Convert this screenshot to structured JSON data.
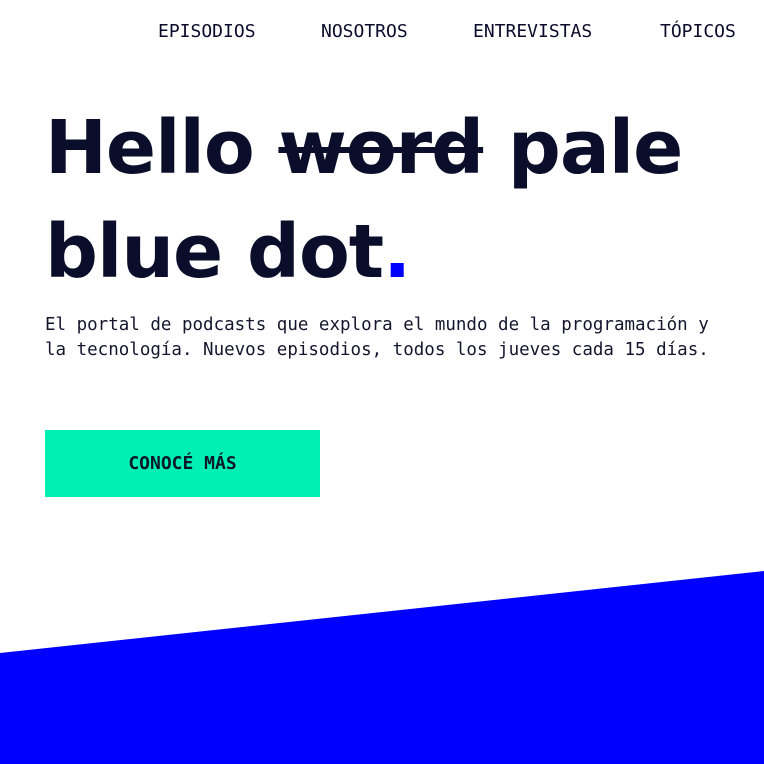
{
  "nav": {
    "items": [
      {
        "label": "EPISODIOS"
      },
      {
        "label": "NOSOTROS"
      },
      {
        "label": "ENTREVISTAS"
      },
      {
        "label": "TÓPICOS"
      }
    ]
  },
  "hero": {
    "headline_part1": "Hello ",
    "headline_struck": "word",
    "headline_part2": " pale blue dot",
    "headline_accent": ".",
    "intro_line1": "El portal de podcasts que explora el mundo de la programación y",
    "intro_line2": "la tecnología. Nuevos episodios, todos los jueves cada 15 días.",
    "cta_label": "CONOCÉ MÁS"
  },
  "colors": {
    "accent_blue": "#0000ff",
    "cta_green": "#00f0b4",
    "text_dark": "#0b0e2a"
  }
}
